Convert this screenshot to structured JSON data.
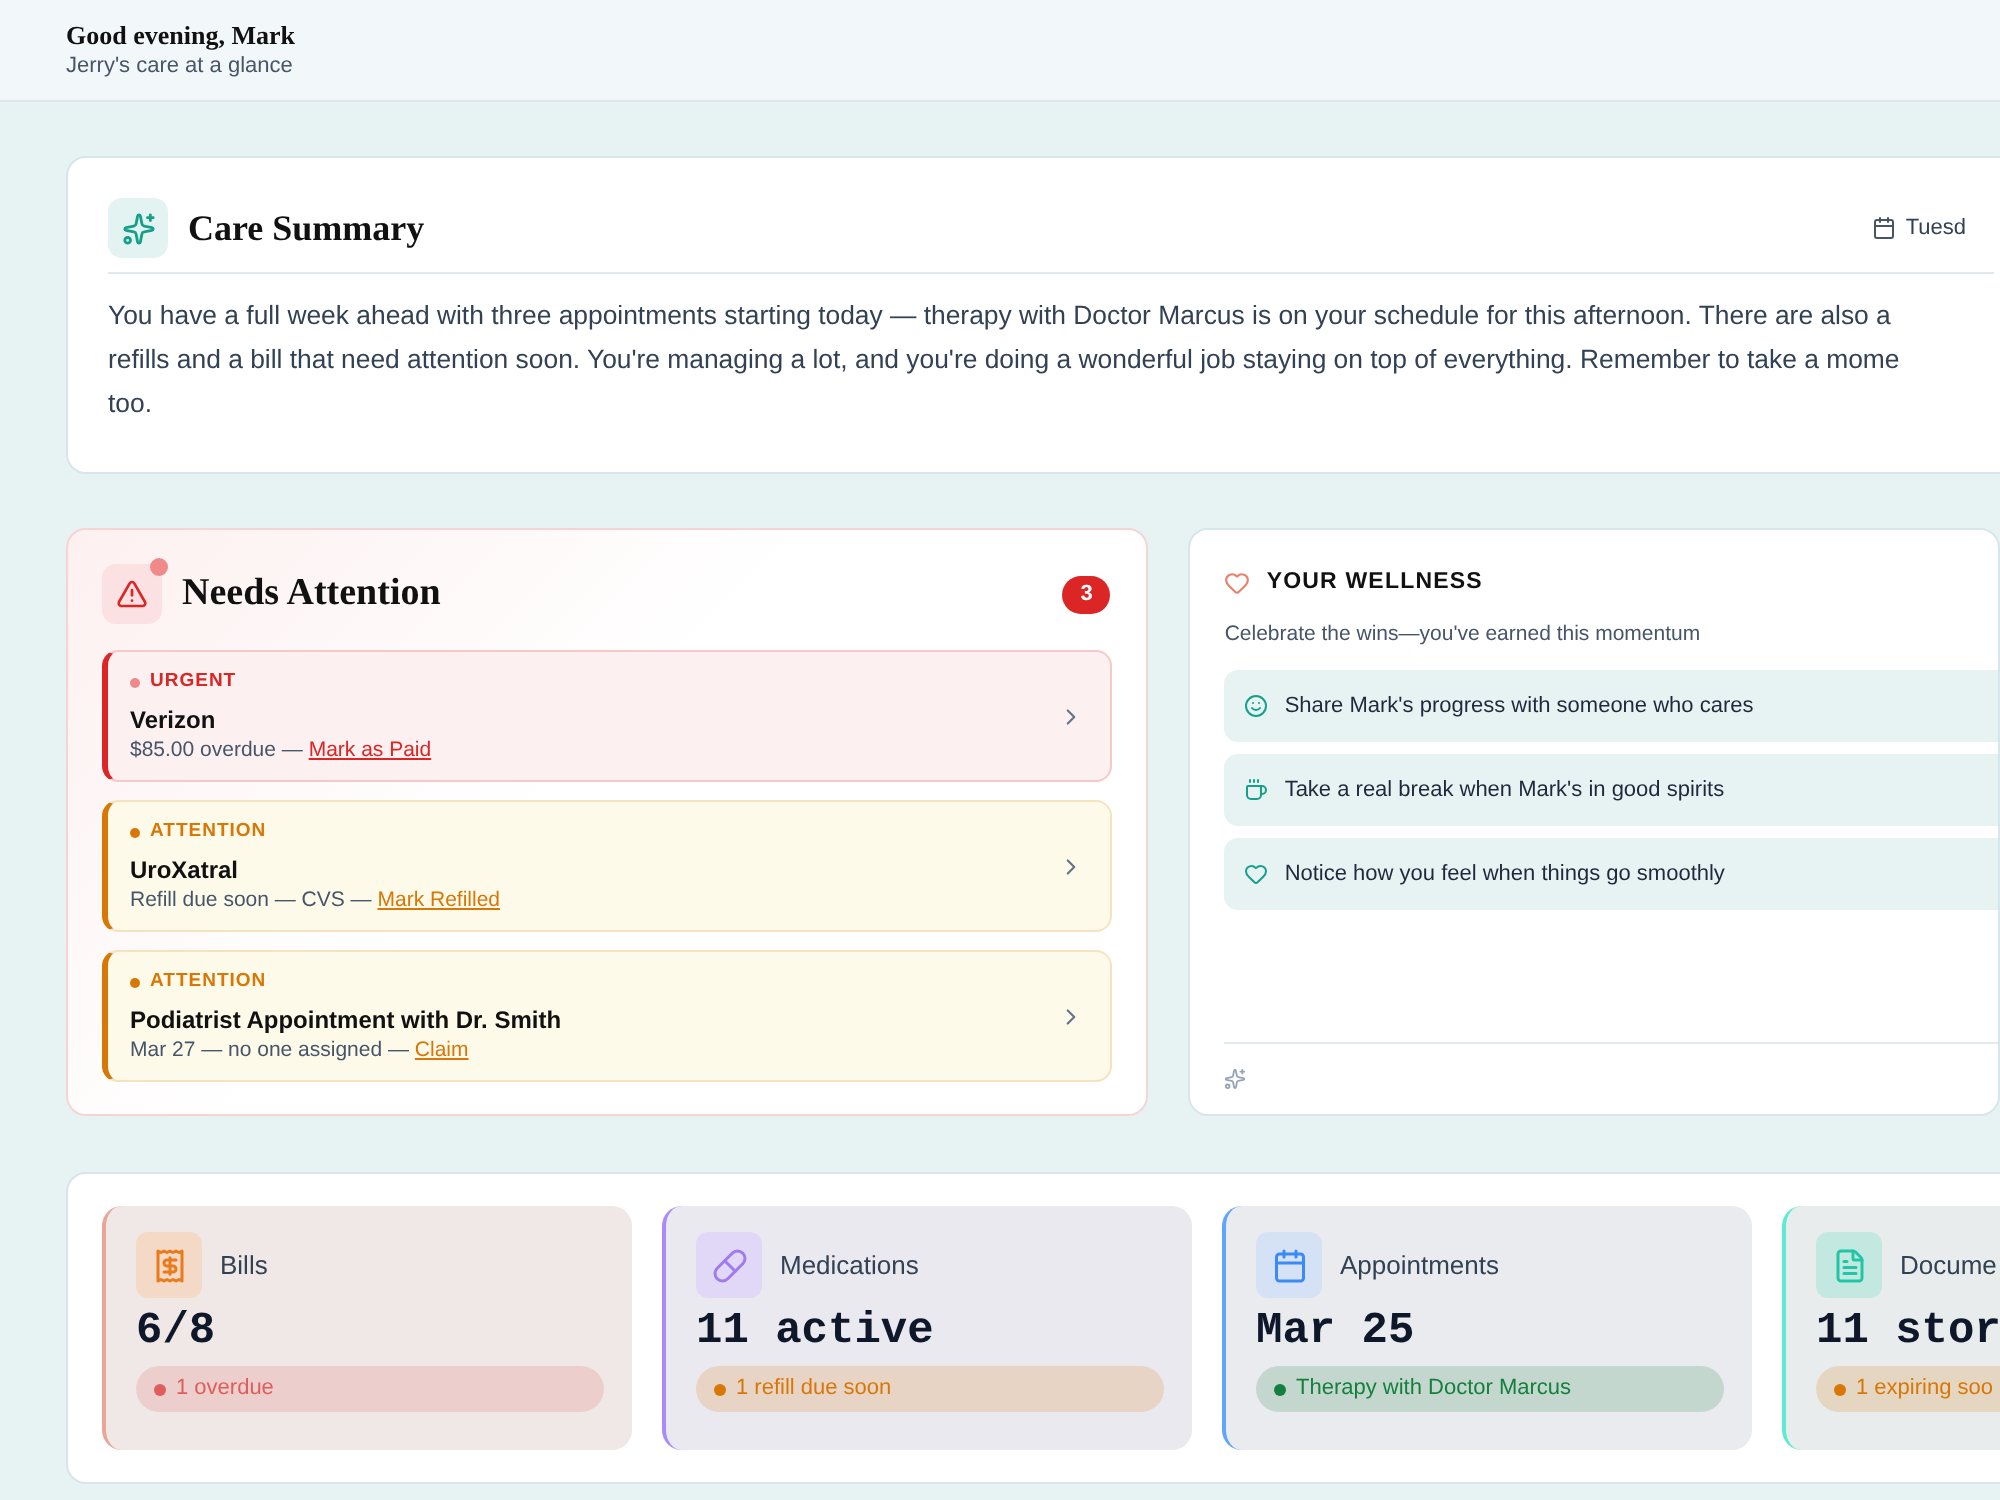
{
  "header": {
    "greeting": "Good evening, Mark",
    "subtitle": "Jerry's care at a glance"
  },
  "summary": {
    "title": "Care Summary",
    "date": "Tuesd",
    "lines": [
      "You have a full week ahead with three appointments starting today — therapy with Doctor Marcus is on your schedule for this afternoon. There are also a",
      "refills and a bill that need attention soon. You're managing a lot, and you're doing a wonderful job staying on top of everything. Remember to take a mome",
      "too."
    ]
  },
  "attention": {
    "title": "Needs Attention",
    "count": "3",
    "items": [
      {
        "kind": "urgent",
        "label": "URGENT",
        "title": "Verizon",
        "detail": "$85.00 overdue —",
        "action": "Mark as Paid"
      },
      {
        "kind": "attention",
        "label": "ATTENTION",
        "title": "UroXatral",
        "detail": "Refill due soon — CVS —",
        "action": "Mark Refilled"
      },
      {
        "kind": "attention",
        "label": "ATTENTION",
        "title": "Podiatrist Appointment with Dr. Smith",
        "detail": "Mar 27 — no one assigned —",
        "action": "Claim"
      }
    ]
  },
  "wellness": {
    "title": "YOUR WELLNESS",
    "subtitle": "Celebrate the wins—you've earned this momentum",
    "items": [
      {
        "kind": "smile",
        "text": "Share Mark's progress with someone who cares"
      },
      {
        "kind": "cup",
        "text": "Take a real break when Mark's in good spirits"
      },
      {
        "kind": "heart",
        "text": "Notice how you feel when things go smoothly"
      }
    ]
  },
  "stats": [
    {
      "kind": "bills",
      "label": "Bills",
      "value": "6/8",
      "status": "1 overdue",
      "color": "#e05d5d"
    },
    {
      "kind": "medications",
      "label": "Medications",
      "value": "11 active",
      "status": "1 refill due soon",
      "color": "#d97706"
    },
    {
      "kind": "appointments",
      "label": "Appointments",
      "value": "Mar 25",
      "status": "Therapy with Doctor Marcus",
      "color": "#15803d"
    },
    {
      "kind": "documents",
      "label": "Docume",
      "value": "11 stor",
      "status": "1 expiring soo",
      "color": "#d97706"
    }
  ]
}
